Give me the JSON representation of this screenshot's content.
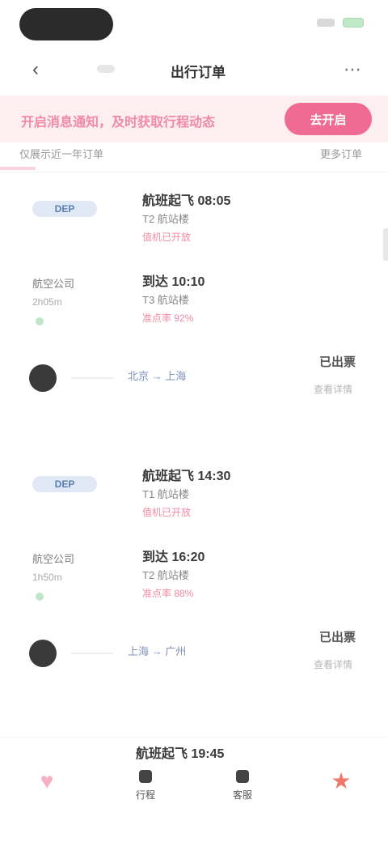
{
  "header": {
    "title": "出行订单"
  },
  "promo": {
    "text": "开启消息通知，及时获取行程动态",
    "button_label": "去开启"
  },
  "subbar": {
    "left": "仅展示近一年订单",
    "right": "更多订单"
  },
  "cards": [
    {
      "departure": {
        "logo": "DEP",
        "title": "航班起飞 08:05",
        "subtitle": "T2 航站楼",
        "tag": "值机已开放"
      },
      "arrival": {
        "brand": "航空公司",
        "time": "2h05m",
        "title": "到达 10:10",
        "subtitle": "T3 航站楼",
        "tag": "准点率 92%"
      },
      "price": {
        "route": "北京 → 上海",
        "label": "已出票",
        "sub": "查看详情"
      }
    },
    {
      "departure": {
        "logo": "DEP",
        "title": "航班起飞 14:30",
        "subtitle": "T1 航站楼",
        "tag": "值机已开放"
      },
      "arrival": {
        "brand": "航空公司",
        "time": "1h50m",
        "title": "到达 16:20",
        "subtitle": "T2 航站楼",
        "tag": "准点率 88%"
      },
      "price": {
        "route": "上海 → 广州",
        "label": "已出票",
        "sub": "查看详情"
      }
    }
  ],
  "bottom": {
    "title": "航班起飞 19:45",
    "items": [
      "行程",
      "客服"
    ]
  },
  "icons": {
    "back": "back-icon",
    "more": "more-icon"
  },
  "colors": {
    "accent": "#ef6b93",
    "promo_bg": "#fdeef2"
  }
}
